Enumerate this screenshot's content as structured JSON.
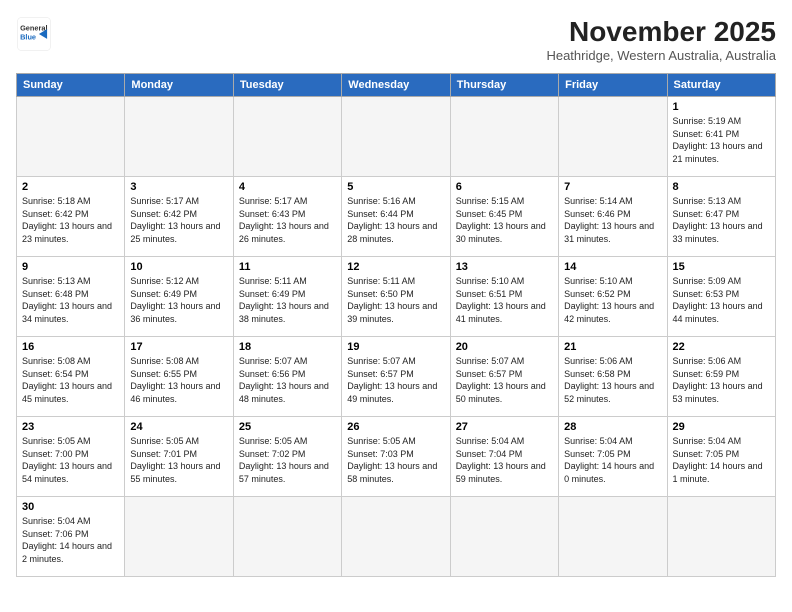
{
  "header": {
    "logo_line1": "General",
    "logo_line2": "Blue",
    "month": "November 2025",
    "location": "Heathridge, Western Australia, Australia"
  },
  "weekdays": [
    "Sunday",
    "Monday",
    "Tuesday",
    "Wednesday",
    "Thursday",
    "Friday",
    "Saturday"
  ],
  "weeks": [
    [
      {
        "day": "",
        "info": ""
      },
      {
        "day": "",
        "info": ""
      },
      {
        "day": "",
        "info": ""
      },
      {
        "day": "",
        "info": ""
      },
      {
        "day": "",
        "info": ""
      },
      {
        "day": "",
        "info": ""
      },
      {
        "day": "1",
        "info": "Sunrise: 5:19 AM\nSunset: 6:41 PM\nDaylight: 13 hours\nand 21 minutes."
      }
    ],
    [
      {
        "day": "2",
        "info": "Sunrise: 5:18 AM\nSunset: 6:42 PM\nDaylight: 13 hours\nand 23 minutes."
      },
      {
        "day": "3",
        "info": "Sunrise: 5:17 AM\nSunset: 6:42 PM\nDaylight: 13 hours\nand 25 minutes."
      },
      {
        "day": "4",
        "info": "Sunrise: 5:17 AM\nSunset: 6:43 PM\nDaylight: 13 hours\nand 26 minutes."
      },
      {
        "day": "5",
        "info": "Sunrise: 5:16 AM\nSunset: 6:44 PM\nDaylight: 13 hours\nand 28 minutes."
      },
      {
        "day": "6",
        "info": "Sunrise: 5:15 AM\nSunset: 6:45 PM\nDaylight: 13 hours\nand 30 minutes."
      },
      {
        "day": "7",
        "info": "Sunrise: 5:14 AM\nSunset: 6:46 PM\nDaylight: 13 hours\nand 31 minutes."
      },
      {
        "day": "8",
        "info": "Sunrise: 5:13 AM\nSunset: 6:47 PM\nDaylight: 13 hours\nand 33 minutes."
      }
    ],
    [
      {
        "day": "9",
        "info": "Sunrise: 5:13 AM\nSunset: 6:48 PM\nDaylight: 13 hours\nand 34 minutes."
      },
      {
        "day": "10",
        "info": "Sunrise: 5:12 AM\nSunset: 6:49 PM\nDaylight: 13 hours\nand 36 minutes."
      },
      {
        "day": "11",
        "info": "Sunrise: 5:11 AM\nSunset: 6:49 PM\nDaylight: 13 hours\nand 38 minutes."
      },
      {
        "day": "12",
        "info": "Sunrise: 5:11 AM\nSunset: 6:50 PM\nDaylight: 13 hours\nand 39 minutes."
      },
      {
        "day": "13",
        "info": "Sunrise: 5:10 AM\nSunset: 6:51 PM\nDaylight: 13 hours\nand 41 minutes."
      },
      {
        "day": "14",
        "info": "Sunrise: 5:10 AM\nSunset: 6:52 PM\nDaylight: 13 hours\nand 42 minutes."
      },
      {
        "day": "15",
        "info": "Sunrise: 5:09 AM\nSunset: 6:53 PM\nDaylight: 13 hours\nand 44 minutes."
      }
    ],
    [
      {
        "day": "16",
        "info": "Sunrise: 5:08 AM\nSunset: 6:54 PM\nDaylight: 13 hours\nand 45 minutes."
      },
      {
        "day": "17",
        "info": "Sunrise: 5:08 AM\nSunset: 6:55 PM\nDaylight: 13 hours\nand 46 minutes."
      },
      {
        "day": "18",
        "info": "Sunrise: 5:07 AM\nSunset: 6:56 PM\nDaylight: 13 hours\nand 48 minutes."
      },
      {
        "day": "19",
        "info": "Sunrise: 5:07 AM\nSunset: 6:57 PM\nDaylight: 13 hours\nand 49 minutes."
      },
      {
        "day": "20",
        "info": "Sunrise: 5:07 AM\nSunset: 6:57 PM\nDaylight: 13 hours\nand 50 minutes."
      },
      {
        "day": "21",
        "info": "Sunrise: 5:06 AM\nSunset: 6:58 PM\nDaylight: 13 hours\nand 52 minutes."
      },
      {
        "day": "22",
        "info": "Sunrise: 5:06 AM\nSunset: 6:59 PM\nDaylight: 13 hours\nand 53 minutes."
      }
    ],
    [
      {
        "day": "23",
        "info": "Sunrise: 5:05 AM\nSunset: 7:00 PM\nDaylight: 13 hours\nand 54 minutes."
      },
      {
        "day": "24",
        "info": "Sunrise: 5:05 AM\nSunset: 7:01 PM\nDaylight: 13 hours\nand 55 minutes."
      },
      {
        "day": "25",
        "info": "Sunrise: 5:05 AM\nSunset: 7:02 PM\nDaylight: 13 hours\nand 57 minutes."
      },
      {
        "day": "26",
        "info": "Sunrise: 5:05 AM\nSunset: 7:03 PM\nDaylight: 13 hours\nand 58 minutes."
      },
      {
        "day": "27",
        "info": "Sunrise: 5:04 AM\nSunset: 7:04 PM\nDaylight: 13 hours\nand 59 minutes."
      },
      {
        "day": "28",
        "info": "Sunrise: 5:04 AM\nSunset: 7:05 PM\nDaylight: 14 hours\nand 0 minutes."
      },
      {
        "day": "29",
        "info": "Sunrise: 5:04 AM\nSunset: 7:05 PM\nDaylight: 14 hours\nand 1 minute."
      }
    ],
    [
      {
        "day": "30",
        "info": "Sunrise: 5:04 AM\nSunset: 7:06 PM\nDaylight: 14 hours\nand 2 minutes."
      },
      {
        "day": "",
        "info": ""
      },
      {
        "day": "",
        "info": ""
      },
      {
        "day": "",
        "info": ""
      },
      {
        "day": "",
        "info": ""
      },
      {
        "day": "",
        "info": ""
      },
      {
        "day": "",
        "info": ""
      }
    ]
  ]
}
